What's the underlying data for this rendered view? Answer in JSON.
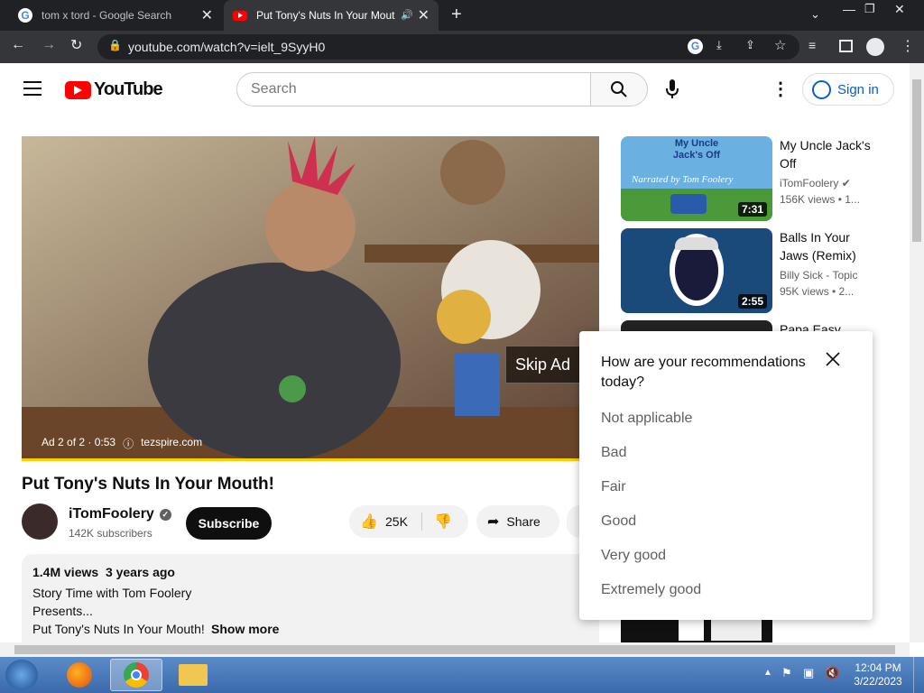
{
  "browser": {
    "tabs": [
      {
        "title": "tom x tord - Google Search",
        "favicon": "G"
      },
      {
        "title": "Put Tony's Nuts In Your Mout",
        "favicon": "youtube-icon"
      }
    ],
    "url": "youtube.com/watch?v=ielt_9SyyH0"
  },
  "youtube": {
    "logo": "YouTube",
    "search_placeholder": "Search",
    "signin": "Sign in",
    "ad": {
      "skip": "Skip Ad",
      "info": "Ad 2 of 2 · 0:53",
      "domain": "tezspire.com"
    },
    "video": {
      "title": "Put Tony's Nuts In Your Mouth!",
      "channel": "iTomFoolery",
      "subscribers": "142K subscribers",
      "subscribe": "Subscribe",
      "likes": "25K",
      "share": "Share",
      "views": "1.4M views",
      "age": "3 years ago",
      "desc_lines": [
        "Story Time with Tom Foolery",
        "Presents...",
        "Put Tony's Nuts In Your Mouth!"
      ],
      "show_more": "Show more"
    },
    "recommendations": [
      {
        "title": "My Uncle Jack's Off",
        "channel": "iTomFoolery",
        "meta": "156K views • 1...",
        "duration": "7:31",
        "thumb_text": "My Uncle Jack's Off",
        "thumb_sub": "Narrated by Tom Foolery"
      },
      {
        "title": "Balls In Your Jaws (Remix)",
        "channel": "Billy Sick - Topic",
        "meta": "95K views • 2...",
        "duration": "2:55"
      },
      {
        "title": "Papa Easy"
      }
    ],
    "popup": {
      "question": "How are your recommendations today?",
      "options": [
        "Not applicable",
        "Bad",
        "Fair",
        "Good",
        "Very good",
        "Extremely good"
      ]
    }
  },
  "taskbar": {
    "time": "12:04 PM",
    "date": "3/22/2023"
  },
  "colors": {
    "youtube_red": "#ff0000",
    "link_blue": "#065fd4",
    "chrome_dark": "#202124"
  }
}
